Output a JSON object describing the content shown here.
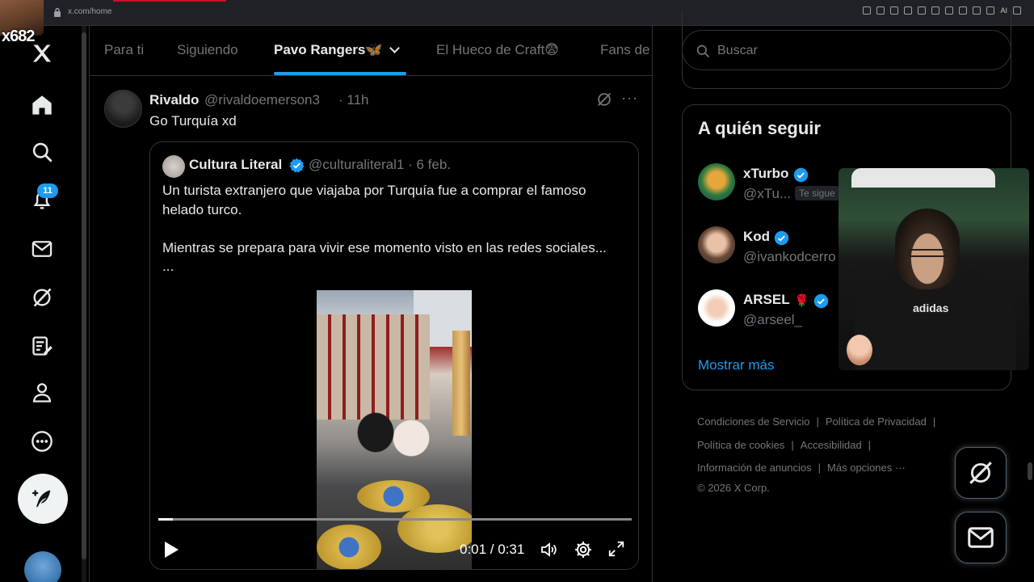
{
  "browser": {
    "url": "x.com/home",
    "ai_label": "AI"
  },
  "overlay": {
    "stream_tag": "x682"
  },
  "nav": {
    "notifications_badge": "11"
  },
  "tabs": [
    {
      "label": "Para ti"
    },
    {
      "label": "Siguiendo"
    },
    {
      "label": "Pavo Rangers🦋"
    },
    {
      "label": "El Hueco de Craft😨"
    },
    {
      "label": "Fans de"
    }
  ],
  "tweet": {
    "name": "Rivaldo",
    "handle": "@rivaldoemerson3",
    "time": "· 11h",
    "text": "Go Turquía xd",
    "more": "···"
  },
  "quote": {
    "name": "Cultura Literal",
    "handle": "@culturaliteral1 · 6 feb.",
    "line1": "Un turista extranjero que viajaba por Turquía fue a comprar el famoso helado turco.",
    "line2": "Mientras se prepara para vivir ese momento visto en las redes sociales...",
    "line3": "...",
    "video_time": "0:01 / 0:31",
    "video_progress_fraction": 0.03
  },
  "search": {
    "placeholder": "Buscar"
  },
  "who_to_follow": {
    "title": "A quién seguir",
    "users": [
      {
        "name": "xTurbo",
        "handle": "@xTu...",
        "follows_you": "Te sigue"
      },
      {
        "name": "Kod",
        "handle": "@ivankodcerro"
      },
      {
        "name": "ARSEL",
        "emoji": "🌹",
        "handle": "@arseel_"
      }
    ],
    "show_more": "Mostrar más"
  },
  "footer": {
    "terms": "Condiciones de Servicio",
    "privacy": "Política de Privacidad",
    "cookies": "Política de cookies",
    "accessibility": "Accesibilidad",
    "ads_info": "Información de anuncios",
    "more_options": "Más opciones ···",
    "copyright": "© 2026 X Corp."
  },
  "webcam": {
    "shirt_logo": "adidas"
  },
  "colors": {
    "accent": "#1d9bf0",
    "background": "#000000",
    "text_primary": "#e7e9ea",
    "text_secondary": "#71767b",
    "border": "#2f3336"
  }
}
